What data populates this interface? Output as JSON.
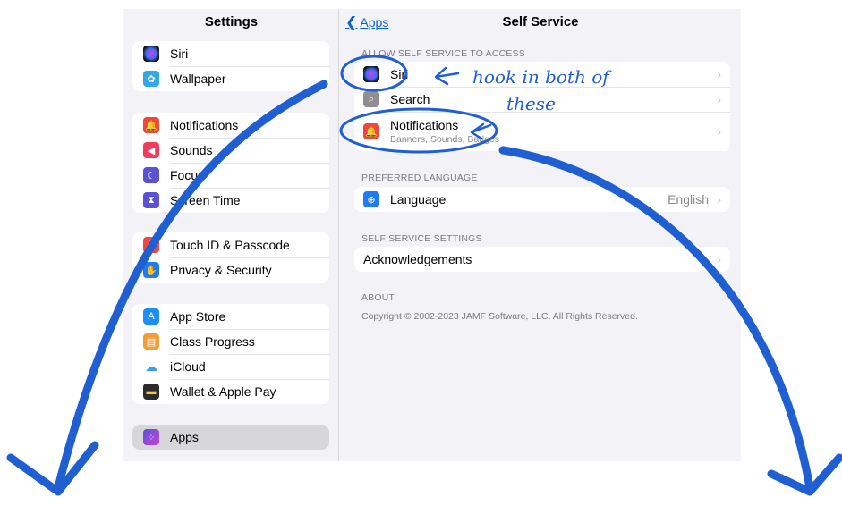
{
  "sidebar": {
    "title": "Settings",
    "groups": [
      [
        {
          "label": "Siri",
          "icon": "siri-icon"
        },
        {
          "label": "Wallpaper",
          "icon": "wallpaper-icon"
        }
      ],
      [
        {
          "label": "Notifications",
          "icon": "notifications-icon"
        },
        {
          "label": "Sounds",
          "icon": "sounds-icon"
        },
        {
          "label": "Focus",
          "icon": "focus-icon"
        },
        {
          "label": "Screen Time",
          "icon": "screen-time-icon"
        }
      ],
      [
        {
          "label": "Touch ID & Passcode",
          "icon": "touch-id-icon"
        },
        {
          "label": "Privacy & Security",
          "icon": "privacy-icon"
        }
      ],
      [
        {
          "label": "App Store",
          "icon": "app-store-icon"
        },
        {
          "label": "Class Progress",
          "icon": "class-progress-icon"
        },
        {
          "label": "iCloud",
          "icon": "icloud-icon"
        },
        {
          "label": "Wallet & Apple Pay",
          "icon": "wallet-icon"
        }
      ],
      [
        {
          "label": "Apps",
          "icon": "apps-icon",
          "selected": true
        }
      ]
    ]
  },
  "detail": {
    "back_label": "Apps",
    "title": "Self Service",
    "sections": {
      "access": {
        "header": "ALLOW SELF SERVICE TO ACCESS",
        "siri": "Siri",
        "search": "Search",
        "notifications": "Notifications",
        "notifications_sub": "Banners, Sounds, Badges"
      },
      "language": {
        "header": "PREFERRED LANGUAGE",
        "label": "Language",
        "value": "English"
      },
      "settings": {
        "header": "SELF SERVICE SETTINGS",
        "acknowledgements": "Acknowledgements"
      },
      "about": {
        "header": "ABOUT",
        "copyright": "Copyright © 2002-2023 JAMF Software, LLC.  All Rights Reserved."
      }
    }
  },
  "annotation": {
    "line1": "hook in both of",
    "line2": "these",
    "color": "#1f5fd1"
  },
  "colors": {
    "accent": "#0a60d8",
    "background": "#f2f2f7"
  }
}
